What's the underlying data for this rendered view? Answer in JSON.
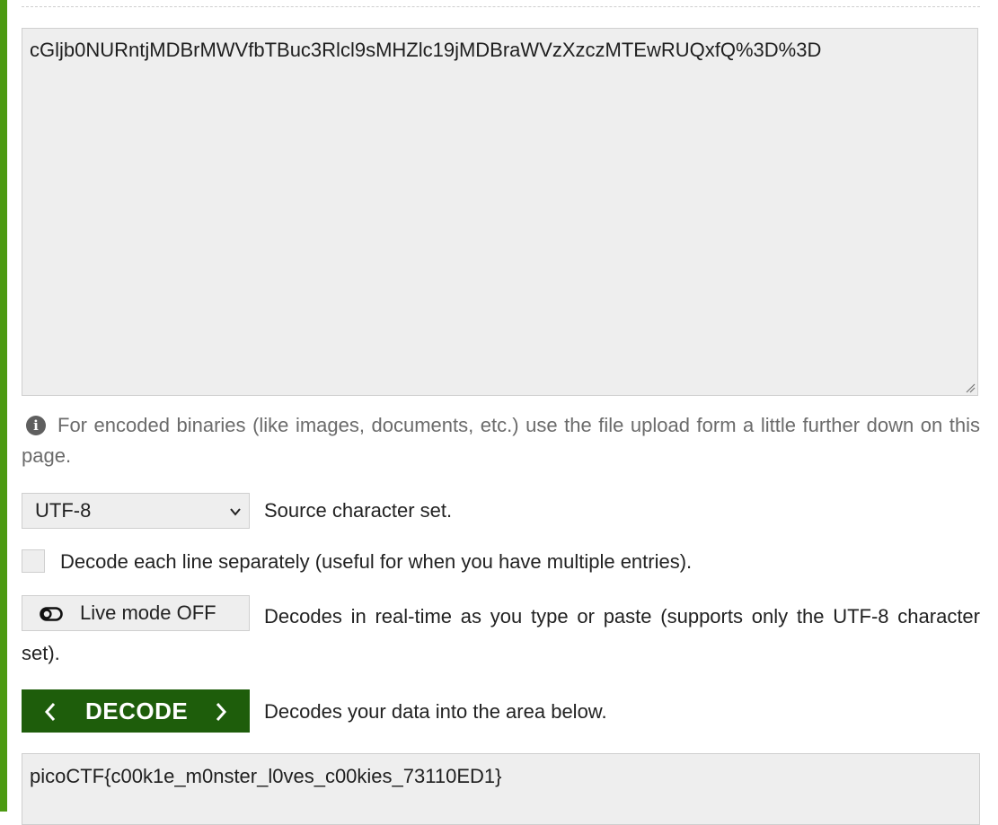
{
  "colors": {
    "accent_green": "#4c9a12",
    "decode_button_bg": "#1e5d0b",
    "field_bg": "#eeeeee"
  },
  "input": {
    "value": "cGljb0NURntjMDBrMWVfbTBuc3Rlcl9sMHZlc19jMDBraWVzXzczMTEwRUQxfQ%3D%3D"
  },
  "info_note": {
    "icon": "info-icon",
    "text": "For encoded binaries (like images, documents, etc.) use the file upload form a little further down on this page."
  },
  "charset": {
    "selected": "UTF-8",
    "description": "Source character set."
  },
  "line_option": {
    "checked": false,
    "label": "Decode each line separately (useful for when you have multiple entries)."
  },
  "live_mode": {
    "icon": "toggle-off-icon",
    "label": "Live mode OFF",
    "description": "Decodes in real-time as you type or paste (supports only the UTF-8 character set)."
  },
  "decode": {
    "label": "DECODE",
    "description": "Decodes your data into the area below."
  },
  "output": {
    "value": "picoCTF{c00k1e_m0nster_l0ves_c00kies_73110ED1}"
  }
}
